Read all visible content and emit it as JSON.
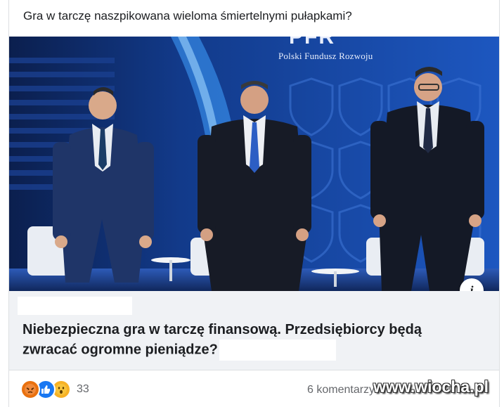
{
  "post": {
    "text": "Gra w tarczę naszpikowana wieloma śmiertelnymi pułapkami?"
  },
  "image": {
    "logo_mark": "PFR",
    "logo_text": "Polski Fundusz Rozwoju",
    "info_icon": "info-icon",
    "info_glyph": "i"
  },
  "link": {
    "headline": "Niebezpieczna gra w tarczę finansową. Przedsiębiorcy będą zwracać ogromne pieniądze?"
  },
  "footer": {
    "reaction_icons": [
      "angry-icon",
      "like-icon",
      "wow-icon"
    ],
    "reaction_count": "33",
    "comments": "6 komentarzy",
    "watermark": "www.wiocha.pl"
  },
  "colors": {
    "page_bg": "#ffffff",
    "link_box_bg": "#f0f2f5",
    "stage_blue": "#1e5bbf",
    "like_blue": "#1877f2"
  }
}
